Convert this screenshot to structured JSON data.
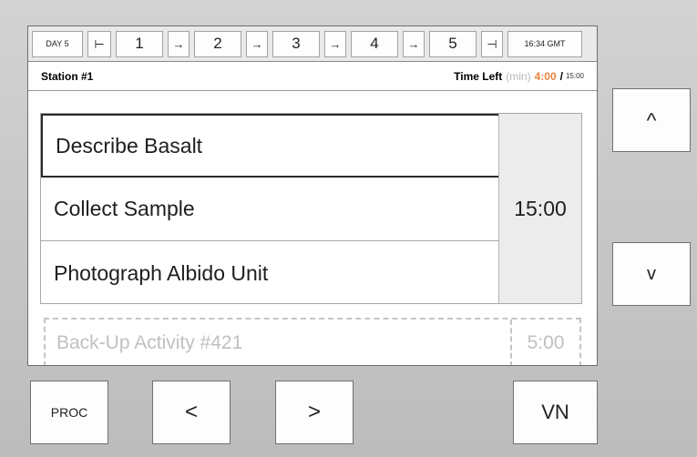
{
  "timeline": {
    "day_label": "DAY 5",
    "start_glyph": "⊢",
    "stations": [
      "1",
      "2",
      "3",
      "4",
      "5"
    ],
    "arrow_glyph": "→",
    "end_glyph": "⊣",
    "clock": "16:34 GMT"
  },
  "station": {
    "name": "Station #1",
    "time_left_label": "Time Left",
    "unit": "(min)",
    "remaining": "4:00",
    "separator": "/",
    "total": "15:00"
  },
  "activities": {
    "items": [
      "Describe Basalt",
      "Collect Sample",
      "Photograph Albido Unit"
    ],
    "duration": "15:00",
    "selected_index": 0
  },
  "backup": {
    "label": "Back-Up Activity #421",
    "duration": "5:00"
  },
  "buttons": {
    "up": "^",
    "down": "v",
    "proc": "PROC",
    "prev": "<",
    "next": ">",
    "vn": "VN"
  },
  "colors": {
    "accent_orange": "#e8833a",
    "bezel": "#c4c4c4",
    "muted_text": "#c0c0c0"
  }
}
